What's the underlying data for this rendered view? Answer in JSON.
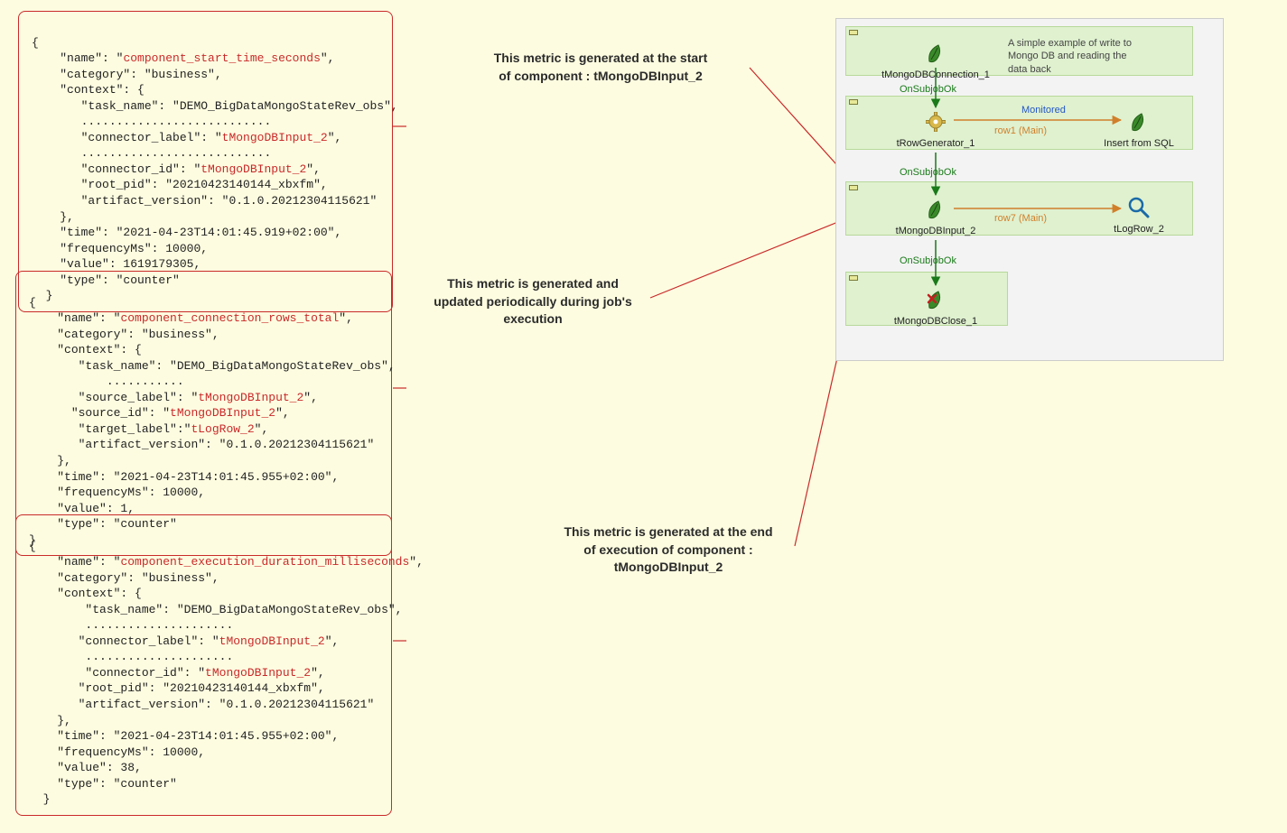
{
  "metrics": [
    {
      "name_label": "\"name\": \"",
      "name_value": "component_start_time_seconds",
      "name_suffix": "\",",
      "category_line": "\"category\": \"business\",",
      "context_open": "\"context\": {",
      "task_line": "   \"task_name\": \"DEMO_BigDataMongoStateRev_obs\",",
      "ellipsis1": "   ...........................",
      "conn_label_pre": "   \"connector_label\": \"",
      "conn_label_val": "tMongoDBInput_2",
      "conn_label_suf": "\",",
      "ellipsis2": "   ...........................",
      "conn_id_pre": "   \"connector_id\": \"",
      "conn_id_val": "tMongoDBInput_2",
      "conn_id_suf": "\",",
      "root_pid_line": "   \"root_pid\": \"20210423140144_xbxfm\",",
      "artifact_line": "   \"artifact_version\": \"0.1.0.20212304115621\"",
      "context_close": "},",
      "time_line": "\"time\": \"2021-04-23T14:01:45.919+02:00\",",
      "freq_line": "\"frequencyMs\": 10000,",
      "value_line": "\"value\": 1619179305,",
      "type_line": "\"type\": \"counter\""
    },
    {
      "name_label": "\"name\": \"",
      "name_value": "component_connection_rows_total",
      "name_suffix": "\",",
      "category_line": "\"category\": \"business\",",
      "context_open": "\"context\": {",
      "task_line": "   \"task_name\": \"DEMO_BigDataMongoStateRev_obs\",",
      "ellipsis1": "       ...........",
      "src_label_pre": "   \"source_label\": \"",
      "src_label_val": "tMongoDBInput_2",
      "src_label_suf": "\",",
      "src_id_pre": "  \"source_id\": \"",
      "src_id_val": "tMongoDBInput_2",
      "src_id_suf": "\",",
      "tgt_pre": "   \"target_label\":\"",
      "tgt_val": "tLogRow_2",
      "tgt_suf": "\",",
      "artifact_line": "   \"artifact_version\": \"0.1.0.20212304115621\"",
      "context_close": "},",
      "time_line": "\"time\": \"2021-04-23T14:01:45.955+02:00\",",
      "freq_line": "\"frequencyMs\": 10000,",
      "value_line": "\"value\": 1,",
      "type_line": "\"type\": \"counter\""
    },
    {
      "name_label": "\"name\": \"",
      "name_value": "component_execution_duration_milliseconds",
      "name_suffix": "\",",
      "category_line": "\"category\": \"business\",",
      "context_open": "\"context\": {",
      "task_line": "    \"task_name\": \"DEMO_BigDataMongoStateRev_obs\",",
      "ellipsis1": "    .....................",
      "conn_label_pre": "   \"connector_label\": \"",
      "conn_label_val": "tMongoDBInput_2",
      "conn_label_suf": "\",",
      "ellipsis2": "    .....................",
      "conn_id_pre": "    \"connector_id\": \"",
      "conn_id_val": "tMongoDBInput_2",
      "conn_id_suf": "\",",
      "root_pid_line": "   \"root_pid\": \"20210423140144_xbxfm\",",
      "artifact_line": "   \"artifact_version\": \"0.1.0.20212304115621\"",
      "context_close": "},",
      "time_line": "\"time\": \"2021-04-23T14:01:45.955+02:00\",",
      "freq_line": "\"frequencyMs\": 10000,",
      "value_line": "\"value\": 38,",
      "type_line": "\"type\": \"counter\""
    }
  ],
  "annotations": {
    "a1_l1": "This metric is generated at the start",
    "a1_l2": "of component : tMongoDBInput_2",
    "a2_l1": "This metric is generated  and",
    "a2_l2": "updated periodically during job's",
    "a2_l3": "execution",
    "a3_l1": "This metric is generated at the end",
    "a3_l2": "of execution of component :",
    "a3_l3": "tMongoDBInput_2"
  },
  "job": {
    "note_l1": "A simple example of write to",
    "note_l2": "Mongo DB and reading the",
    "note_l3": "data back",
    "comp_mongoconn": "tMongoDBConnection_1",
    "onsub1": "OnSubjobOk",
    "comp_rowgen": "tRowGenerator_1",
    "comp_insert": "Insert from SQL",
    "monitored": "Monitored",
    "row1": "row1 (Main)",
    "onsub2": "OnSubjobOk",
    "comp_mongoinput": "tMongoDBInput_2",
    "comp_logrow": "tLogRow_2",
    "row7": "row7 (Main)",
    "onsub3": "OnSubjobOk",
    "comp_mongoclose": "tMongoDBClose_1"
  }
}
